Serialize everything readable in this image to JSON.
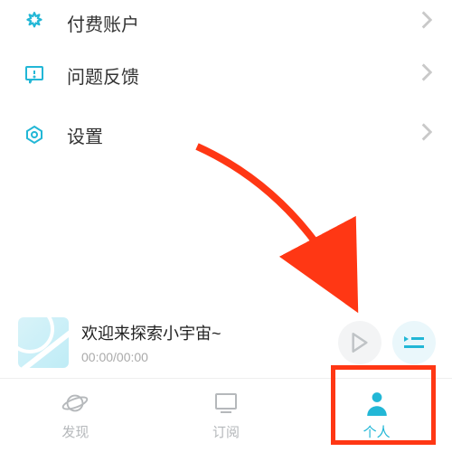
{
  "colors": {
    "accent": "#22b7d6",
    "highlight": "#ff3714",
    "muted": "#b5b8bb"
  },
  "menu": {
    "paid_account": "付费账户",
    "feedback": "问题反馈",
    "settings": "设置"
  },
  "player": {
    "title": "欢迎来探索小宇宙~",
    "time": "00:00/00:00"
  },
  "nav": {
    "discover": "发现",
    "subscribe": "订阅",
    "profile": "个人"
  }
}
